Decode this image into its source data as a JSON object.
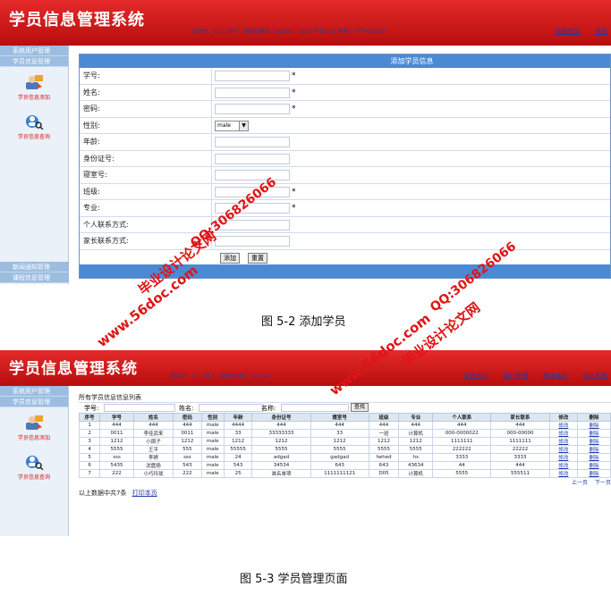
{
  "app": {
    "title": "学员信息管理系统",
    "header_info": "您的IP：1.0  |  用户：超级管理员（admin）  2017年4月9日 星期日  下午6:05:57",
    "header_info_list": "您的IP：1.0  |  用户：超级管理员（admin）",
    "header_links_form": [
      "系统首页",
      "退出"
    ],
    "header_links_list": [
      "系统首页",
      "用户管理",
      "系统维护",
      "退出系统"
    ],
    "sidebar": {
      "top_links": [
        "系统用户管理",
        "学员信息管理"
      ],
      "blocks": [
        {
          "label": "学员信息添加",
          "icon": "add-user-icon"
        },
        {
          "label": "学员信息查询",
          "icon": "search-user-icon"
        }
      ],
      "bottom_links": [
        "新闻通知管理",
        "课程信息管理"
      ]
    }
  },
  "form": {
    "header": "添加学员信息",
    "fields": [
      {
        "label": "学号:",
        "required": "*"
      },
      {
        "label": "姓名:",
        "required": "*"
      },
      {
        "label": "密码:",
        "required": "*"
      },
      {
        "label": "性别:",
        "select_value": "male"
      },
      {
        "label": "年龄:"
      },
      {
        "label": "身份证号:"
      },
      {
        "label": "寝室号:"
      },
      {
        "label": "班级:",
        "required": "*"
      },
      {
        "label": "专业:",
        "required": "*"
      },
      {
        "label": "个人联系方式:"
      },
      {
        "label": "家长联系方式:"
      }
    ],
    "add_label": "添加",
    "reset_label": "重置"
  },
  "captions": {
    "fig1": "图 5-2  添加学员",
    "fig2": "图 5-3  学员管理页面"
  },
  "list": {
    "title": "所有学员信息信息列表",
    "search": {
      "id_label": "学号:",
      "name_label": "姓名:",
      "class_label": "名称:",
      "button": "查找"
    },
    "columns": [
      "序号",
      "学号",
      "姓名",
      "密码",
      "性别",
      "年龄",
      "身份证号",
      "寝室号",
      "班级",
      "专业",
      "个人联系",
      "家长联系",
      "修改",
      "删除"
    ],
    "rows": [
      [
        "1",
        "444",
        "444",
        "444",
        "male",
        "4444",
        "444",
        "444",
        "444",
        "444",
        "444",
        "444",
        "修改",
        "删除"
      ],
      [
        "2",
        "0011",
        "李佳武来",
        "0011",
        "male",
        "33",
        "33333333",
        "33",
        "一班",
        "计算机",
        "000-0000022",
        "000-00000",
        "修改",
        "删除"
      ],
      [
        "3",
        "1212",
        "小周子",
        "1212",
        "male",
        "1212",
        "1212",
        "1212",
        "1212",
        "1212",
        "1111111",
        "1111111",
        "修改",
        "删除"
      ],
      [
        "4",
        "5555",
        "王平",
        "555",
        "male",
        "55555",
        "5555",
        "5555",
        "5555",
        "5555",
        "222222",
        "22222",
        "修改",
        "删除"
      ],
      [
        "5",
        "sss",
        "李婷",
        "sss",
        "male",
        "24",
        "adgad",
        "gadgad",
        "hehed",
        "hs",
        "3333",
        "3333",
        "修改",
        "删除"
      ],
      [
        "6",
        "5435",
        "沈震扬",
        "543",
        "male",
        "543",
        "34534",
        "643",
        "643",
        "43634",
        "44",
        "444",
        "修改",
        "删除"
      ],
      [
        "7",
        "222",
        "小巧玲珑",
        "222",
        "male",
        "25",
        "准名单项",
        "1111111121",
        "D05",
        "计算机",
        "5555",
        "555511",
        "修改",
        "删除"
      ]
    ],
    "pager": [
      "上一页",
      "下一页"
    ],
    "summary": "以上数据中共7条",
    "print": "打印本页"
  },
  "watermarks": {
    "site": "www.56doc.com",
    "qq": "QQ:306826066",
    "brand": "毕业设计论文网"
  },
  "colors": {
    "header_red": "#c81414",
    "panel_blue": "#4a8ad4",
    "sidebar_bg": "#eaf1f8",
    "watermark_red": "#e01414"
  }
}
